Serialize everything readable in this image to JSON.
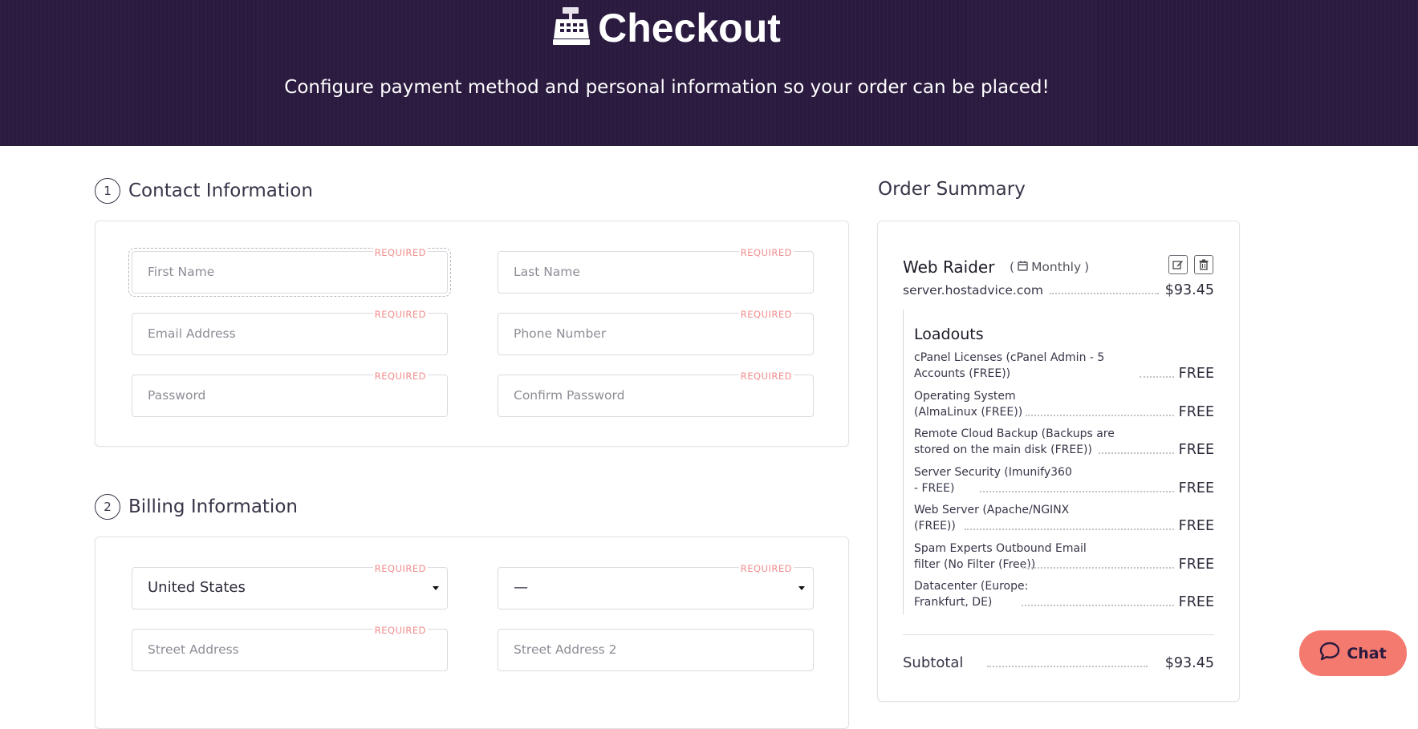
{
  "header": {
    "title": "Checkout",
    "subtitle": "Configure payment method and personal information so your order can be placed!"
  },
  "contact": {
    "step": "1",
    "title": "Contact Information",
    "required_label": "REQUIRED",
    "fields": {
      "first_name": "First Name",
      "last_name": "Last Name",
      "email": "Email Address",
      "phone": "Phone Number",
      "password": "Password",
      "confirm_password": "Confirm Password"
    }
  },
  "billing": {
    "step": "2",
    "title": "Billing Information",
    "country": "United States",
    "state": "—",
    "street": "Street Address",
    "street2": "Street Address 2"
  },
  "summary": {
    "title": "Order Summary",
    "product": {
      "name": "Web Raider",
      "cycle_open": "(",
      "cycle": "Monthly",
      "cycle_close": ")",
      "hostname": "server.hostadvice.com",
      "price": "$93.45"
    },
    "loadouts_title": "Loadouts",
    "loadouts": [
      {
        "label_line1": "cPanel Licenses (cPanel Admin - 5",
        "label_line2": "Accounts (FREE))",
        "price": "FREE"
      },
      {
        "label_line1": "Operating System",
        "label_line2": "(AlmaLinux (FREE))",
        "price": "FREE"
      },
      {
        "label_line1": "Remote Cloud Backup (Backups are",
        "label_line2": "stored on the main disk (FREE))",
        "price": "FREE"
      },
      {
        "label_line1": "Server Security (Imunify360",
        "label_line2": "- FREE)",
        "price": "FREE"
      },
      {
        "label_line1": "Web Server (Apache/NGINX",
        "label_line2": "(FREE))",
        "price": "FREE"
      },
      {
        "label_line1": "Spam Experts Outbound Email",
        "label_line2": "filter (No Filter (Free))",
        "price": "FREE"
      },
      {
        "label_line1": "Datacenter (Europe:",
        "label_line2": "Frankfurt, DE)",
        "price": "FREE"
      }
    ],
    "subtotal_label": "Subtotal",
    "subtotal": "$93.45"
  },
  "chat": {
    "label": "Chat"
  },
  "icons": [
    "cash-register-icon",
    "calendar-icon",
    "edit-icon",
    "trash-icon",
    "chat-bubble-icon"
  ]
}
